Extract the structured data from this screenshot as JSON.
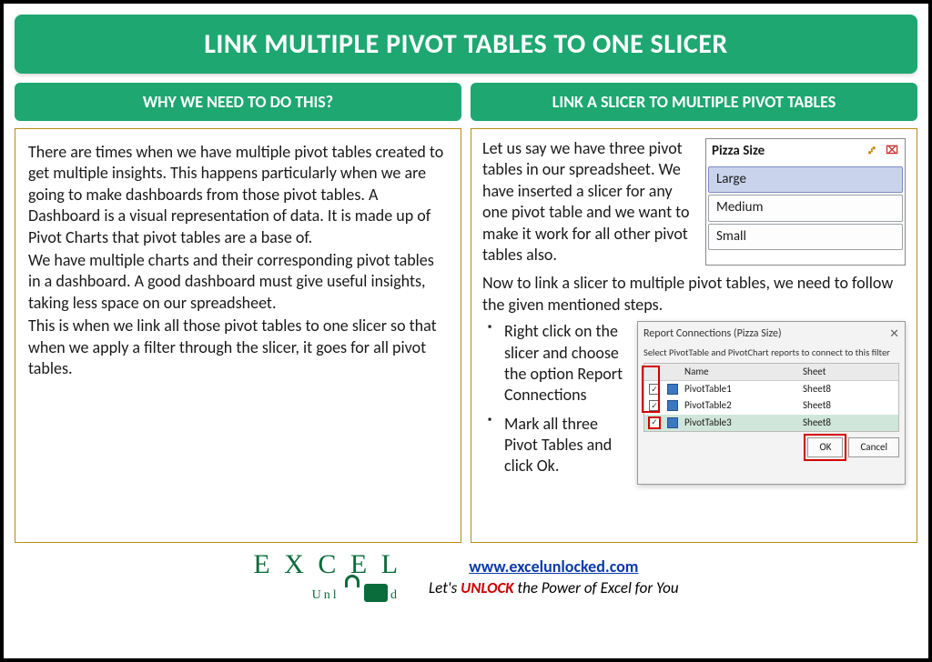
{
  "title": "LINK MULTIPLE PIVOT TABLES TO ONE SLICER",
  "left": {
    "header": "WHY WE NEED TO DO THIS?",
    "p1": "There are times when we have multiple pivot tables created to get multiple insights. This happens particularly when we are going to make dashboards from those pivot tables. A Dashboard is a visual representation of data. It is made up of Pivot Charts that pivot tables are a base of.",
    "p2": "We have multiple charts and their corresponding pivot tables in a dashboard. A good dashboard must give useful insights, taking less space on our spreadsheet.",
    "p3": "This is when we link all those pivot tables to one slicer so that when we apply a filter through the slicer, it goes for all pivot tables."
  },
  "right": {
    "header": "LINK A SLICER TO MULTIPLE PIVOT TABLES",
    "intro": "Let us say we have three pivot tables in our spreadsheet. We have inserted a slicer for any one pivot table and we want to make it work for all other pivot tables also.",
    "slicer": {
      "title": "Pizza Size",
      "options": [
        "Large",
        "Medium",
        "Small"
      ],
      "selected": 0
    },
    "mid": "Now to link a slicer to multiple pivot tables, we need to follow the given mentioned steps.",
    "steps": [
      "Right click on the slicer and choose the option Report Connections",
      "Mark all three Pivot Tables and click Ok."
    ],
    "dialog": {
      "title": "Report Connections (Pizza Size)",
      "subtitle": "Select PivotTable and PivotChart reports to connect to this filter",
      "cols": [
        "Name",
        "Sheet"
      ],
      "rows": [
        {
          "name": "PivotTable1",
          "sheet": "Sheet8"
        },
        {
          "name": "PivotTable2",
          "sheet": "Sheet8"
        },
        {
          "name": "PivotTable3",
          "sheet": "Sheet8"
        }
      ],
      "ok": "OK",
      "cancel": "Cancel"
    }
  },
  "footer": {
    "logo_top": "E X C E L",
    "logo_sub": "U n l   c k e d",
    "url": "www.excelunlocked.com",
    "tag_pre": "Let's ",
    "tag_unlock": "UNLOCK",
    "tag_post": " the Power of Excel for You"
  }
}
